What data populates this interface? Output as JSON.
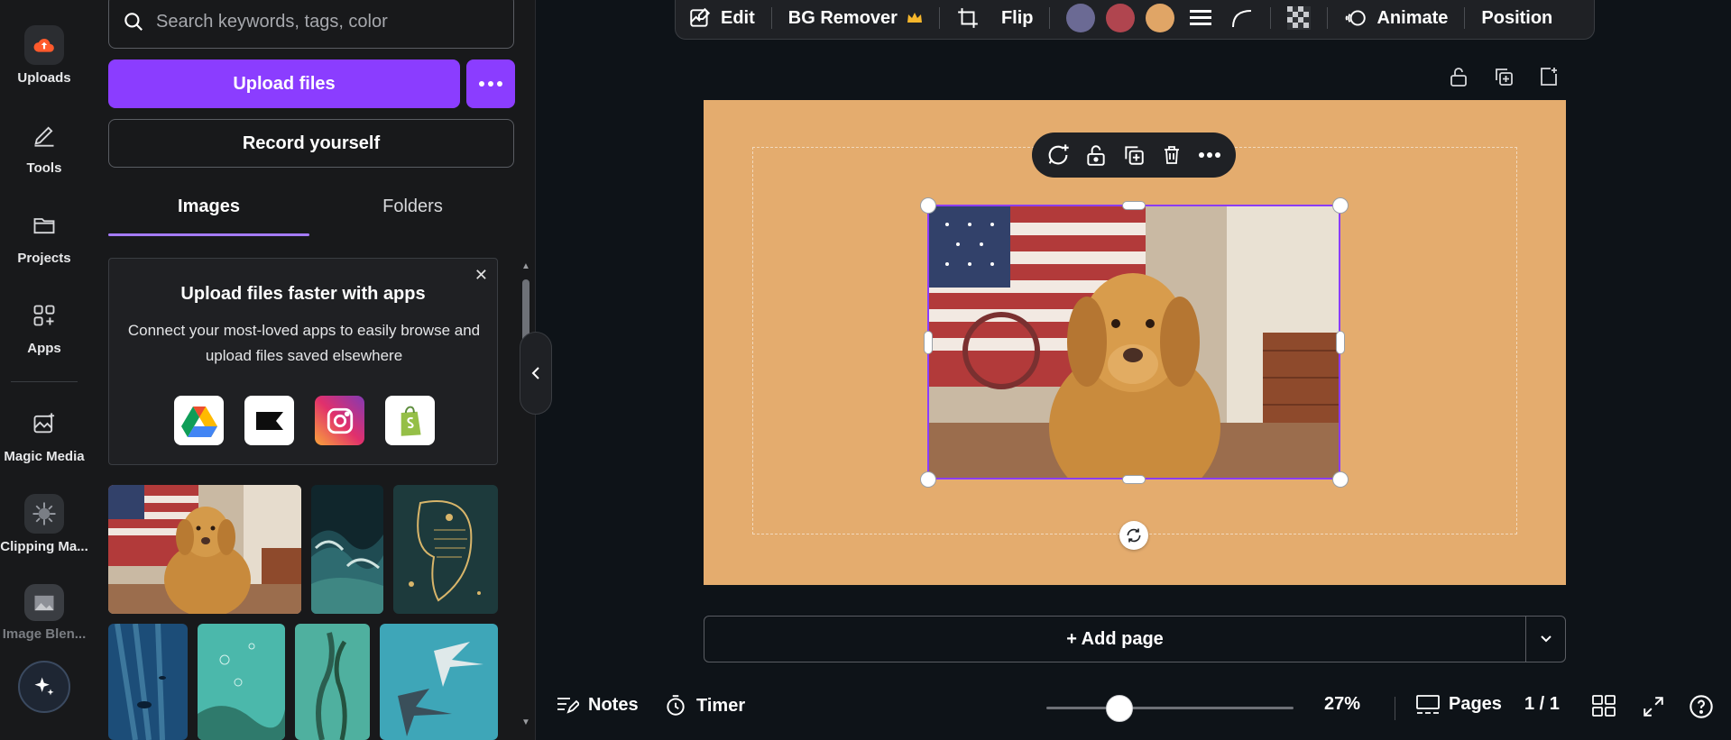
{
  "rail": {
    "items": [
      {
        "label": "Uploads",
        "icon": "cloud-upload-icon"
      },
      {
        "label": "Tools",
        "icon": "pen-tool-icon"
      },
      {
        "label": "Projects",
        "icon": "folder-icon"
      },
      {
        "label": "Apps",
        "icon": "apps-grid-icon"
      },
      {
        "label": "Magic Media",
        "icon": "magic-media-icon"
      },
      {
        "label": "Clipping Ma...",
        "icon": "clipping-magic-icon"
      },
      {
        "label": "Image Blen...",
        "icon": "image-blend-icon"
      }
    ],
    "assistant_icon": "sparkle-icon"
  },
  "panel": {
    "search_placeholder": "Search keywords, tags, color",
    "upload_label": "Upload files",
    "record_label": "Record yourself",
    "tabs": [
      "Images",
      "Folders"
    ],
    "active_tab": "Images",
    "promo": {
      "title": "Upload files faster with apps",
      "description": "Connect your most-loved apps to easily browse and upload files saved elsewhere",
      "apps": [
        "google-drive-icon",
        "box-icon",
        "instagram-icon",
        "shopify-icon"
      ]
    },
    "thumbnails": [
      "golden-retriever-flag",
      "stormy-ocean",
      "ornate-fish-art",
      "underwater-diver",
      "underwater-bubbles",
      "kelp-forest",
      "manta-rays"
    ]
  },
  "toolbar": {
    "edit": "Edit",
    "bg_remover": "BG Remover",
    "flip": "Flip",
    "swatches": [
      "#6b6a94",
      "#b0454f",
      "#e0a566"
    ],
    "animate": "Animate",
    "position": "Position"
  },
  "canvas": {
    "background": "#e4ac6e",
    "add_page": "+ Add page"
  },
  "footer": {
    "notes": "Notes",
    "timer": "Timer",
    "zoom": "27%",
    "zoom_level": 0.27,
    "pages": "Pages",
    "page_count": "1 / 1"
  }
}
